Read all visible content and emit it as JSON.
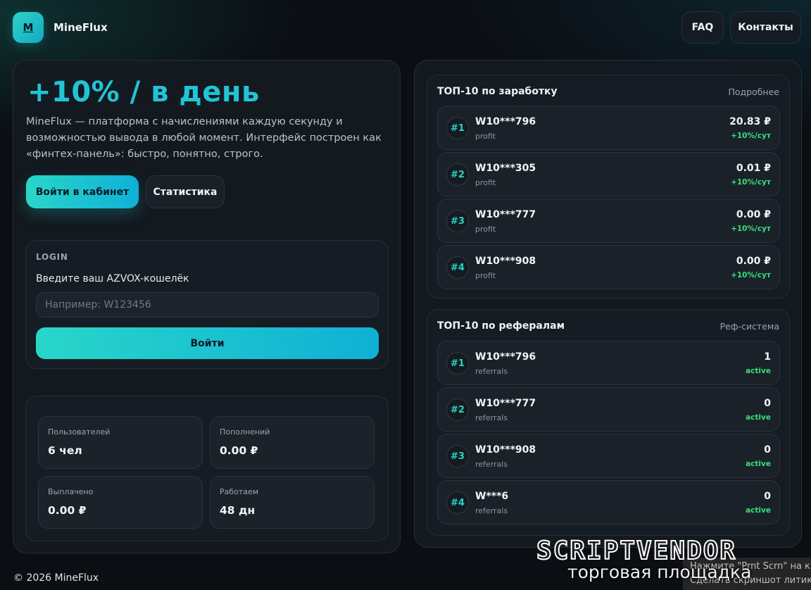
{
  "header": {
    "logo_letter": "M",
    "brand": "MineFlux",
    "nav": [
      {
        "label": "FAQ"
      },
      {
        "label": "Контакты"
      }
    ]
  },
  "hero": {
    "title": "+10% / в день",
    "description": "MineFlux — платформа с начислениями каждую секунду и возможностью вывода в любой момент. Интерфейс построен как «финтех-панель»: быстро, понятно, строго.",
    "primary_button": "Войти в кабинет",
    "secondary_button": "Статистика"
  },
  "login": {
    "title": "LOGIN",
    "label": "Введите ваш AZVOX-кошелёк",
    "placeholder": "Например: W123456",
    "value": "",
    "button": "Войти"
  },
  "stats": [
    {
      "label": "Пользователей",
      "value": "6 чел"
    },
    {
      "label": "Пополнений",
      "value": "0.00 ₽"
    },
    {
      "label": "Выплачено",
      "value": "0.00 ₽"
    },
    {
      "label": "Работаем",
      "value": "48 дн"
    }
  ],
  "top_earnings": {
    "title": "ТОП-10 по заработку",
    "link": "Подробнее",
    "rows": [
      {
        "rank": "#1",
        "name": "W10***796",
        "sub": "profit",
        "value": "20.83 ₽",
        "badge": "+10%/сут"
      },
      {
        "rank": "#2",
        "name": "W10***305",
        "sub": "profit",
        "value": "0.01 ₽",
        "badge": "+10%/сут"
      },
      {
        "rank": "#3",
        "name": "W10***777",
        "sub": "profit",
        "value": "0.00 ₽",
        "badge": "+10%/сут"
      },
      {
        "rank": "#4",
        "name": "W10***908",
        "sub": "profit",
        "value": "0.00 ₽",
        "badge": "+10%/сут"
      }
    ]
  },
  "top_referrals": {
    "title": "ТОП-10 по рефералам",
    "link": "Реф-система",
    "rows": [
      {
        "rank": "#1",
        "name": "W10***796",
        "sub": "referrals",
        "value": "1",
        "badge": "active"
      },
      {
        "rank": "#2",
        "name": "W10***777",
        "sub": "referrals",
        "value": "0",
        "badge": "active"
      },
      {
        "rank": "#3",
        "name": "W10***908",
        "sub": "referrals",
        "value": "0",
        "badge": "active"
      },
      {
        "rank": "#4",
        "name": "W***6",
        "sub": "referrals",
        "value": "0",
        "badge": "active"
      }
    ]
  },
  "footer": {
    "text": "© 2026 MineFlux"
  },
  "watermark": {
    "logo": "SCRIPTVENDOR",
    "subtitle": "торговая площадка",
    "hint_line1": "Нажмите \"Prnt Scrn\" на к",
    "hint_line2": "Сделать скриншот  литика"
  },
  "colors": {
    "accent": "#21c4d6",
    "accent_gradient_start": "#2ad6c9",
    "accent_gradient_end": "#0fb0d6",
    "positive": "#34e07a",
    "background": "#0b0f14"
  }
}
